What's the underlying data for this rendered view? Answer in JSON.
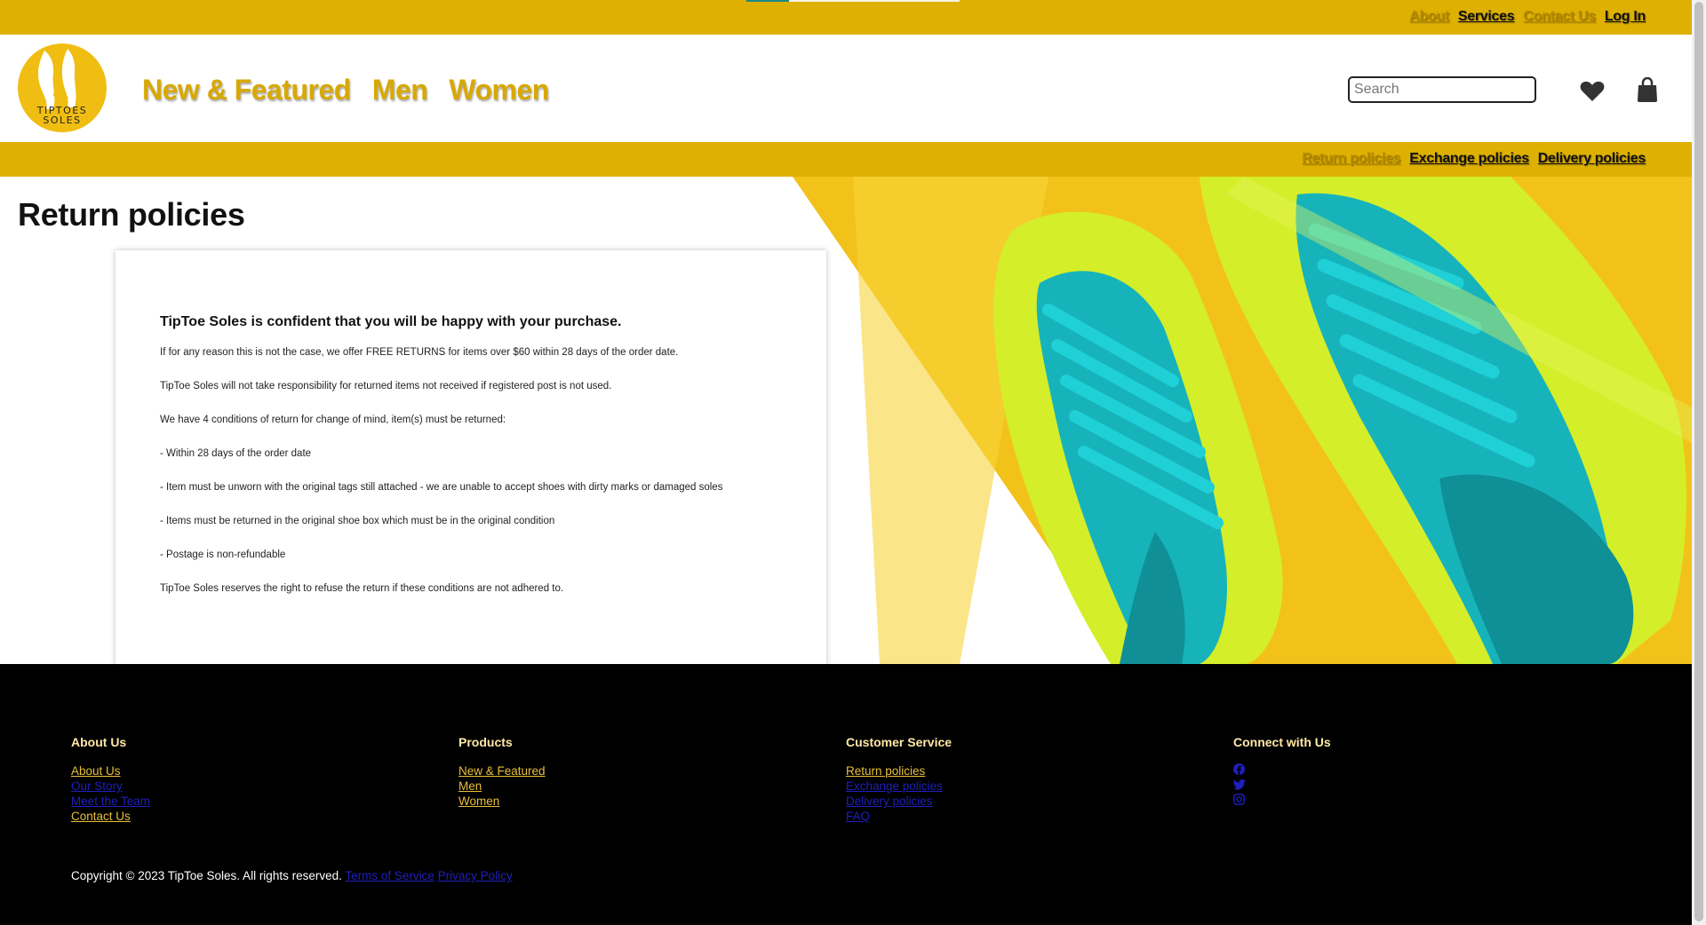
{
  "top_nav": {
    "links": [
      {
        "label": "About",
        "state": "dim"
      },
      {
        "label": "Services",
        "state": "active"
      },
      {
        "label": "Contact Us",
        "state": "dim"
      },
      {
        "label": "Log In",
        "state": "active"
      }
    ]
  },
  "brand": {
    "logo_line1": "TIPTOES",
    "logo_line2": "SOLES",
    "color": "#f0bd12"
  },
  "main_nav": [
    "New & Featured",
    "Men",
    "Women"
  ],
  "search": {
    "placeholder": "Search",
    "value": ""
  },
  "header_icons": [
    "heart-icon",
    "shopping-bag-icon"
  ],
  "policy_nav": {
    "links": [
      {
        "label": "Return policies",
        "state": "dim"
      },
      {
        "label": "Exchange policies",
        "state": "active"
      },
      {
        "label": "Delivery policies",
        "state": "active"
      }
    ]
  },
  "page": {
    "title": "Return policies",
    "heading": "TipToe Soles is confident that you will be happy with your purchase.",
    "paragraphs": [
      "If for any reason this is not the case, we offer FREE RETURNS for items over $60 within 28 days of the order date.",
      "TipToe Soles will not take responsibility for returned items not received if registered post is not used.",
      "We have 4 conditions of return for change of mind, item(s) must be returned:",
      "- Within 28 days of the order date",
      "- Item must be unworn with the original tags still attached - we are unable to accept shoes with dirty marks or damaged soles",
      "- Items must be returned in the original shoe box which must be in the original condition",
      "- Postage is non-refundable",
      "TipToe Soles reserves the right to refuse the return if these conditions are not adhered to."
    ]
  },
  "footer": {
    "columns": [
      {
        "title": "About Us",
        "links": [
          {
            "label": "About Us",
            "style": "gold"
          },
          {
            "label": "Our Story",
            "style": "blue"
          },
          {
            "label": "Meet the Team",
            "style": "blue"
          },
          {
            "label": "Contact Us",
            "style": "gold"
          }
        ]
      },
      {
        "title": "Products",
        "links": [
          {
            "label": "New & Featured",
            "style": "gold"
          },
          {
            "label": "Men",
            "style": "gold"
          },
          {
            "label": "Women",
            "style": "gold"
          }
        ]
      },
      {
        "title": "Customer Service",
        "links": [
          {
            "label": "Return policies",
            "style": "gold"
          },
          {
            "label": "Exchange policies",
            "style": "blue"
          },
          {
            "label": "Delivery policies",
            "style": "blue"
          },
          {
            "label": "FAQ",
            "style": "blue"
          }
        ]
      },
      {
        "title": "Connect with Us",
        "social": [
          "facebook-icon",
          "twitter-icon",
          "instagram-icon"
        ]
      }
    ],
    "copyright": "Copyright © 2023 TipToe Soles. All rights reserved.",
    "legal_links": [
      "Terms of Service",
      "Privacy Policy"
    ]
  },
  "colors": {
    "brand_yellow": "#deb002",
    "nav_gold": "#d8a800",
    "footer_gold": "#e9bf3a",
    "footer_blue": "#1f1fbd",
    "shoe_teal": "#17b3bb",
    "shoe_lime": "#d4ee2a"
  }
}
